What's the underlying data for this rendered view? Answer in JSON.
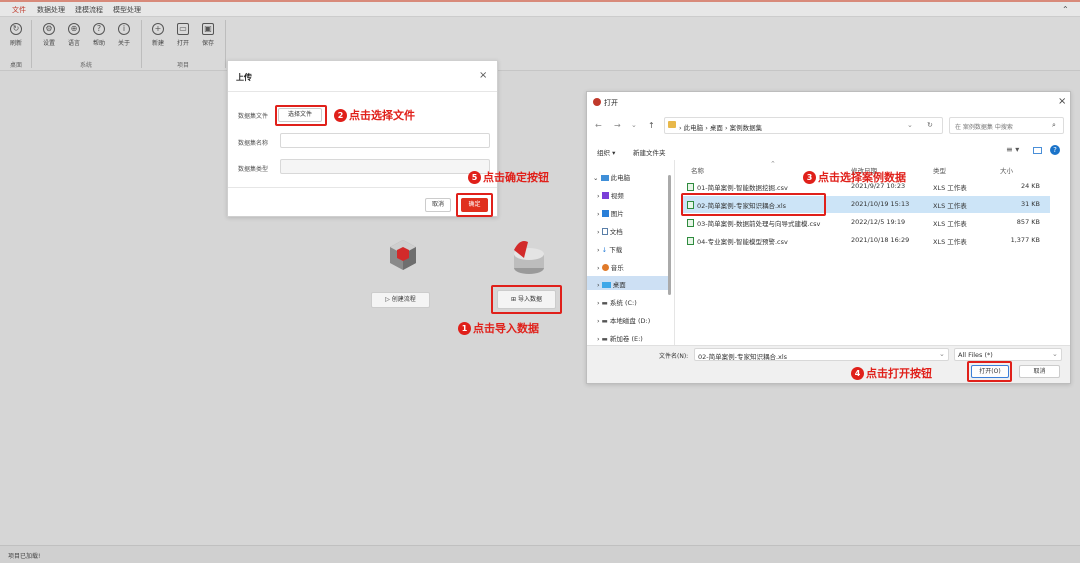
{
  "menu": [
    "文件",
    "数据处理",
    "建模流程",
    "模型处理"
  ],
  "ribbon": {
    "buttons": [
      {
        "label": "刷新",
        "glyph": "↻"
      },
      {
        "label": "设置",
        "glyph": "⚙"
      },
      {
        "label": "语言",
        "glyph": "⊕"
      },
      {
        "label": "帮助",
        "glyph": "?"
      },
      {
        "label": "关于",
        "glyph": "i"
      },
      {
        "label": "新建",
        "glyph": "+"
      },
      {
        "label": "打开",
        "glyph": "▭"
      },
      {
        "label": "保存",
        "glyph": "▣"
      }
    ],
    "groups": [
      "桌面",
      "系统",
      "项目"
    ]
  },
  "upload_dialog": {
    "title": "上传",
    "close": "×",
    "dataset_file_label": "数据集文件",
    "choose_file": "选择文件",
    "dataset_name_label": "数据集名称",
    "dataset_type_label": "数据集类型",
    "cancel": "取消",
    "confirm": "确定"
  },
  "workspace": {
    "create_flow": "▷ 创建流程",
    "import_data": "⊞ 导入数据"
  },
  "annotations": {
    "a1": {
      "num": "1",
      "text": "点击导入数据"
    },
    "a2": {
      "num": "2",
      "text": "点击选择文件"
    },
    "a3": {
      "num": "3",
      "text": "点击选择案例数据"
    },
    "a4": {
      "num": "4",
      "text": "点击打开按钮"
    },
    "a5": {
      "num": "5",
      "text": "点击确定按钮"
    }
  },
  "open_dialog": {
    "title": "打开",
    "close": "×",
    "breadcrumb": [
      "此电脑",
      "桌面",
      "案例数据集"
    ],
    "search_placeholder": "在 案例数据集 中搜索",
    "organize": "组织 ▾",
    "new_folder": "新建文件夹",
    "nav": [
      "此电脑",
      "视频",
      "图片",
      "文档",
      "下载",
      "音乐",
      "桌面",
      "系统 (C:)",
      "本地磁盘 (D:)",
      "新加卷 (E:)"
    ],
    "columns": [
      "名称",
      "修改日期",
      "类型",
      "大小"
    ],
    "files": [
      {
        "name": "01-简单案例-智能数据挖掘.csv",
        "date": "2021/9/27 10:23",
        "type": "XLS 工作表",
        "size": "24 KB"
      },
      {
        "name": "02-简单案例-专家知识耦合.xls",
        "date": "2021/10/19 15:13",
        "type": "XLS 工作表",
        "size": "31 KB"
      },
      {
        "name": "03-简单案例-数据前处理与向导式建模.csv",
        "date": "2022/12/5 19:19",
        "type": "XLS 工作表",
        "size": "857 KB"
      },
      {
        "name": "04-专业案例-智能模型预警.csv",
        "date": "2021/10/18 16:29",
        "type": "XLS 工作表",
        "size": "1,377 KB"
      }
    ],
    "filename_label": "文件名(N):",
    "filename_value": "02-简单案例-专家知识耦合.xls",
    "filetype": "All Files (*)",
    "open_btn": "打开(O)",
    "cancel_btn": "取消"
  },
  "status": "项目已加载!"
}
